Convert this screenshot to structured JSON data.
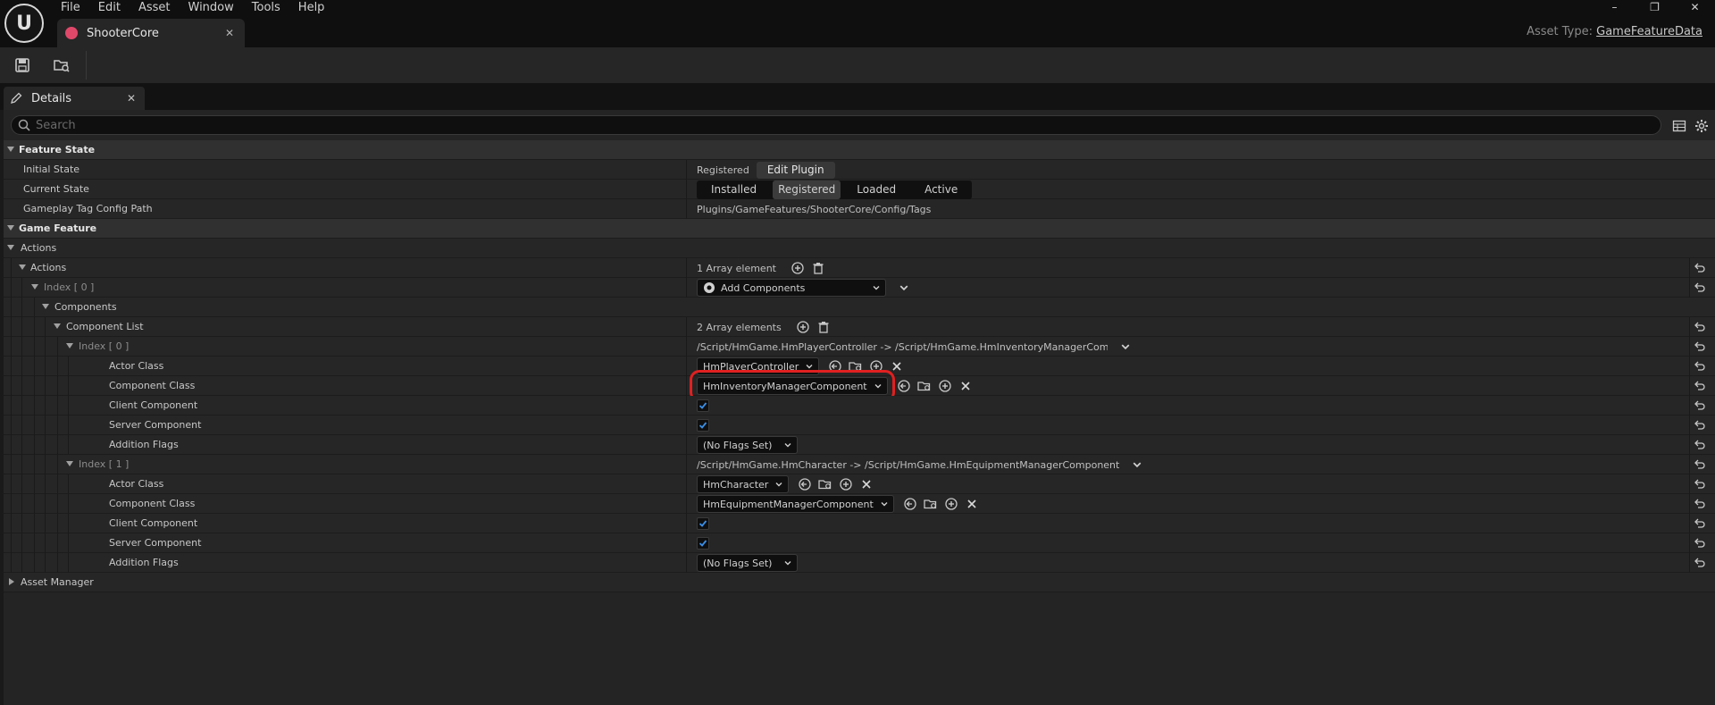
{
  "menu": [
    "File",
    "Edit",
    "Asset",
    "Window",
    "Tools",
    "Help"
  ],
  "document_tab": {
    "label": "ShooterCore"
  },
  "asset_type": {
    "prefix": "Asset Type: ",
    "value": "GameFeatureData"
  },
  "panel": {
    "tab_label": "Details",
    "search_placeholder": "Search"
  },
  "feature_state": {
    "category": "Feature State",
    "initial_state": {
      "name": "Initial State",
      "value": "Registered",
      "button": "Edit Plugin"
    },
    "current_state": {
      "name": "Current State",
      "options": [
        "Installed",
        "Registered",
        "Loaded",
        "Active"
      ],
      "selected": "Registered"
    },
    "tag_config": {
      "name": "Gameplay Tag Config Path",
      "value": "Plugins/GameFeatures/ShooterCore/Config/Tags"
    }
  },
  "game_feature": {
    "category": "Game Feature",
    "actions_group": "Actions",
    "actions_array": {
      "name": "Actions",
      "count": "1 Array element"
    },
    "index0": {
      "name": "Index [ 0 ]",
      "value": "Add Components"
    },
    "components": "Components",
    "component_list": {
      "name": "Component List",
      "count": "2 Array elements"
    },
    "entries": [
      {
        "name": "Index [ 0 ]",
        "summary": "/Script/HmGame.HmPlayerController -> /Script/HmGame.HmInventoryManagerComponent",
        "actor_class_label": "Actor Class",
        "actor_class": "HmPlayerController",
        "component_class_label": "Component Class",
        "component_class": "HmInventoryManagerComponent",
        "client_label": "Client Component",
        "server_label": "Server Component",
        "flags_label": "Addition Flags",
        "flags": "(No Flags Set)",
        "client_checked": true,
        "server_checked": true
      },
      {
        "name": "Index [ 1 ]",
        "summary": "/Script/HmGame.HmCharacter -> /Script/HmGame.HmEquipmentManagerComponent",
        "actor_class_label": "Actor Class",
        "actor_class": "HmCharacter",
        "component_class_label": "Component Class",
        "component_class": "HmEquipmentManagerComponent",
        "client_label": "Client Component",
        "server_label": "Server Component",
        "flags_label": "Addition Flags",
        "flags": "(No Flags Set)",
        "client_checked": true,
        "server_checked": true
      }
    ]
  },
  "asset_manager": {
    "category": "Asset Manager"
  },
  "colors": {
    "highlight": "#e02020",
    "checkbox_check": "#3a8ee6",
    "tab_icon": "#e0486a"
  }
}
